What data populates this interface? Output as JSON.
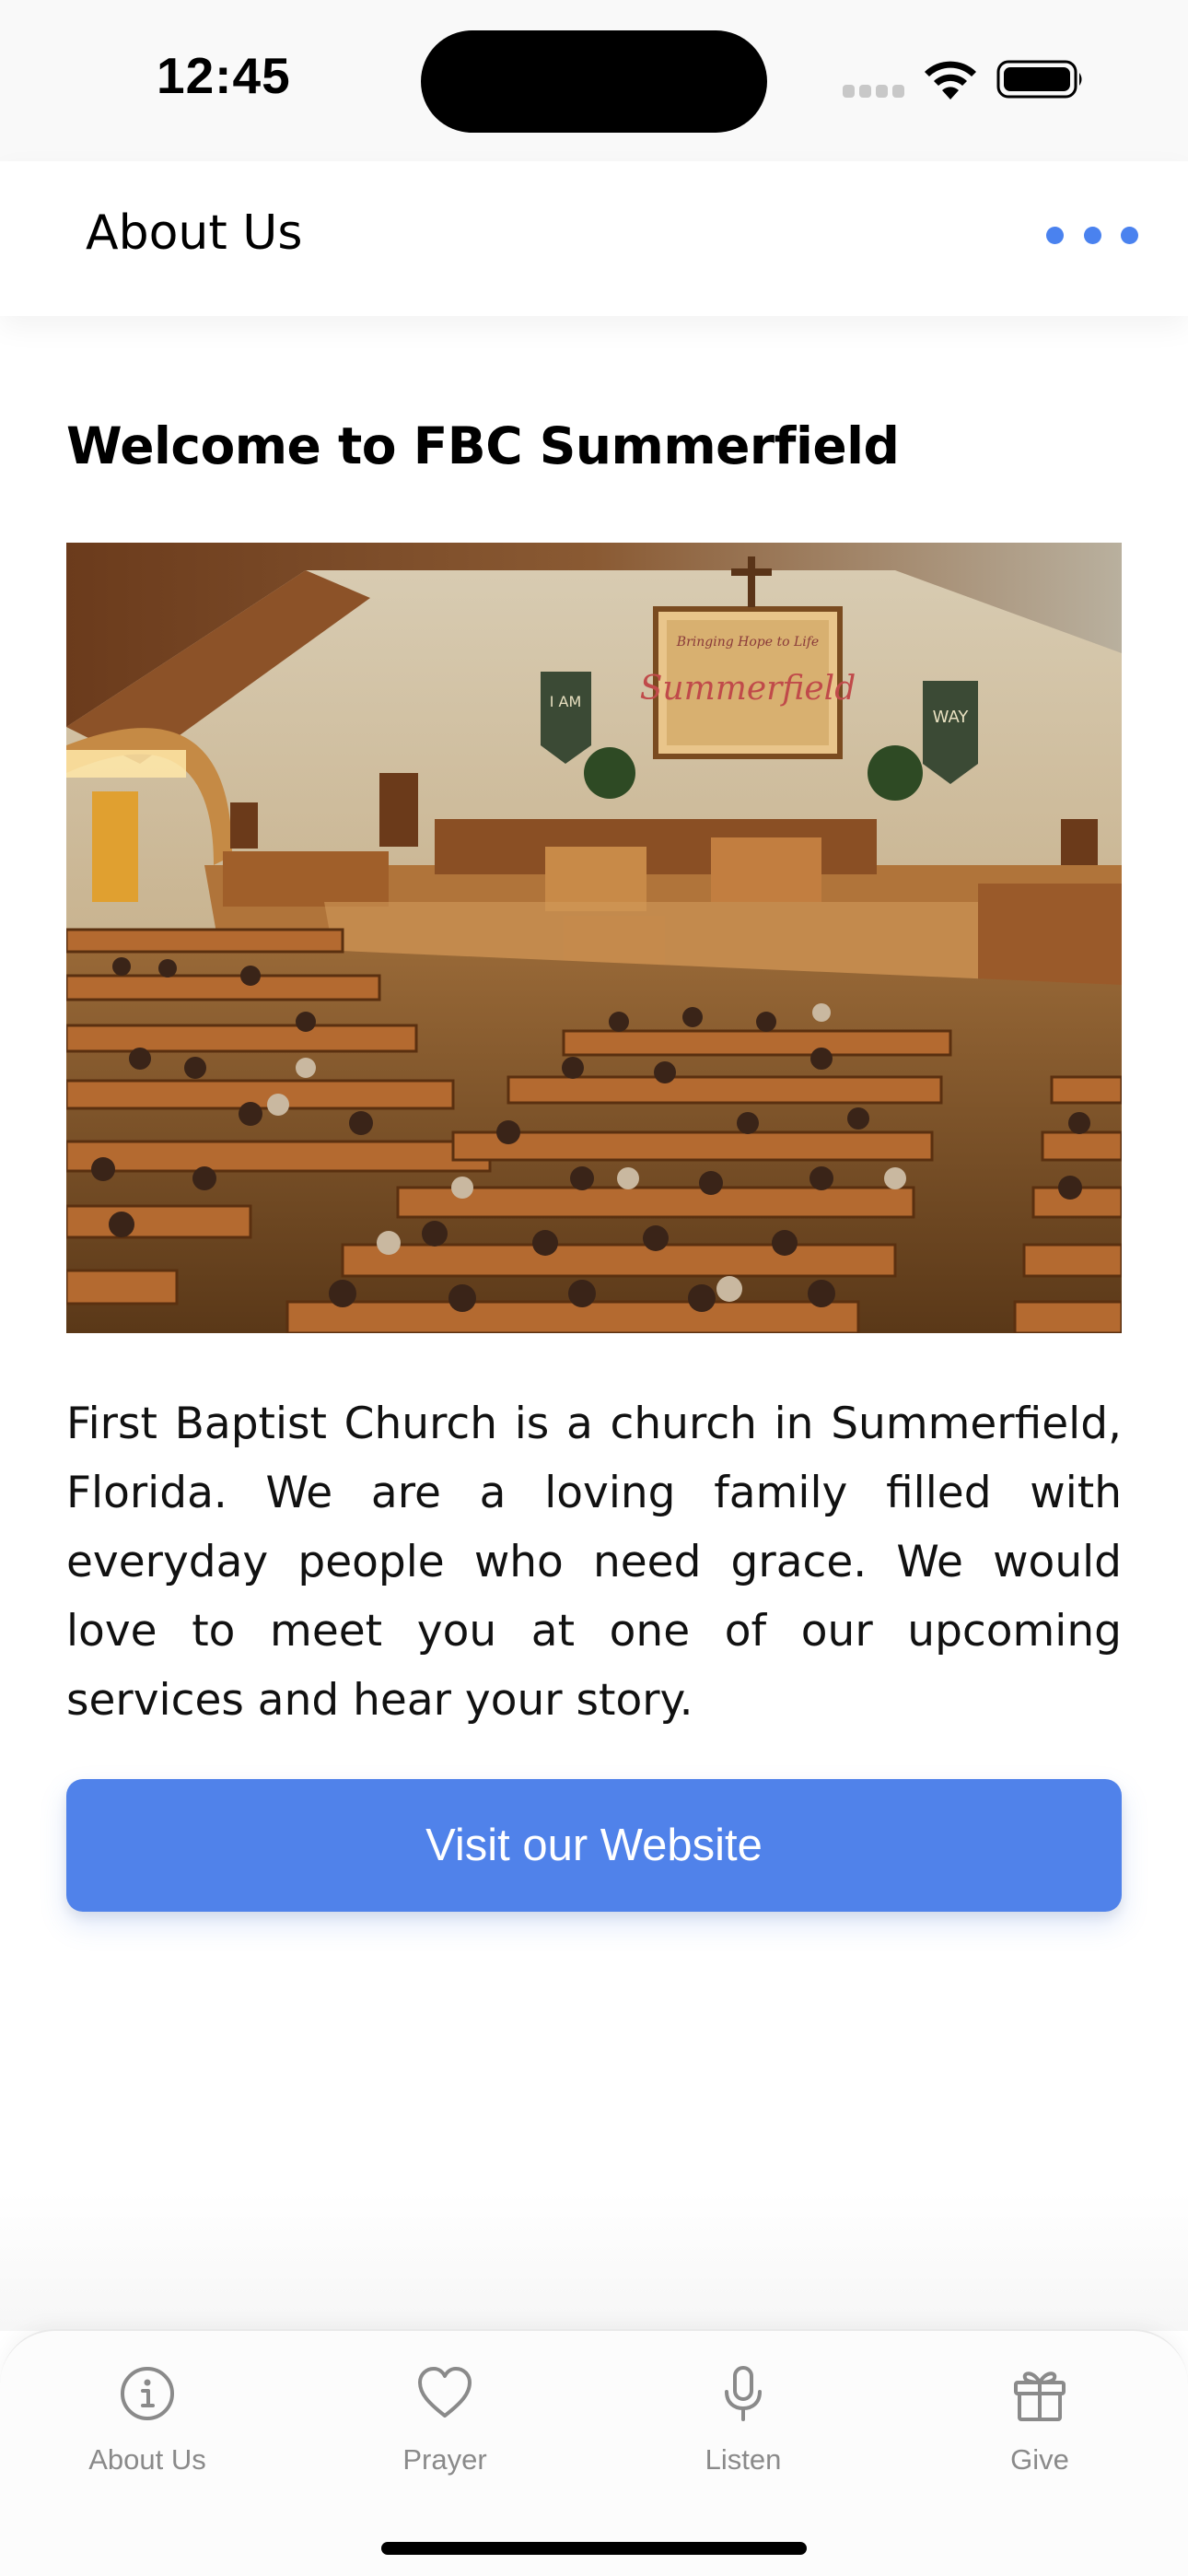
{
  "status_bar": {
    "time": "12:45"
  },
  "header": {
    "title": "About Us",
    "more_icon": "ellipsis-icon",
    "accent_color": "#4a82ef"
  },
  "content": {
    "heading": "Welcome to FBC Summerfield",
    "photo": {
      "screen_text": "Summerfield",
      "screen_tagline": "Bringing Hope to Life",
      "banner_left": "I AM",
      "banner_right": "WAY"
    },
    "description": "First Baptist Church is a church in Summerfield, Florida. We are a loving family filled with everyday people who need grace. We would love to meet you at one of our upcoming services and hear your story.",
    "button_label": "Visit our Website",
    "button_color": "#5082ea"
  },
  "tab_bar": {
    "tabs": [
      {
        "label": "About Us",
        "icon": "info-icon"
      },
      {
        "label": "Prayer",
        "icon": "heart-icon"
      },
      {
        "label": "Listen",
        "icon": "microphone-icon"
      },
      {
        "label": "Give",
        "icon": "gift-icon"
      }
    ]
  }
}
